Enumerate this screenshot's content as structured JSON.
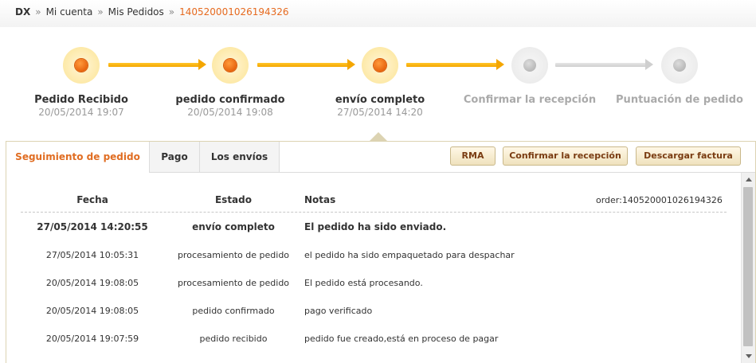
{
  "breadcrumb": {
    "home": "DX",
    "sep": "»",
    "items": [
      "Mi cuenta",
      "Mis Pedidos"
    ],
    "current": "140520001026194326"
  },
  "steps": [
    {
      "title": "Pedido Recibido",
      "time": "20/05/2014 19:07",
      "state": "done"
    },
    {
      "title": "pedido confirmado",
      "time": "20/05/2014 19:08",
      "state": "done"
    },
    {
      "title": "envío completo",
      "time": "27/05/2014 14:20",
      "state": "done"
    },
    {
      "title": "Confirmar la recepción",
      "time": "",
      "state": "todo"
    },
    {
      "title": "Puntuación de pedido",
      "time": "",
      "state": "todo"
    }
  ],
  "tabs": [
    {
      "label": "Seguimiento de pedido",
      "active": true
    },
    {
      "label": "Pago",
      "active": false
    },
    {
      "label": "Los envíos",
      "active": false
    }
  ],
  "actions": {
    "rma": "RMA",
    "confirm": "Confirmar la recepción",
    "invoice": "Descargar factura"
  },
  "table": {
    "headers": {
      "date": "Fecha",
      "status": "Estado",
      "notes": "Notas"
    },
    "order_ref": "order:140520001026194326",
    "rows": [
      {
        "date": "27/05/2014 14:20:55",
        "status": "envío completo",
        "notes": "El pedido ha sido enviado.",
        "highlight": true
      },
      {
        "date": "27/05/2014 10:05:31",
        "status": "procesamiento de pedido",
        "notes": "el pedido ha sido empaquetado para despachar",
        "highlight": false
      },
      {
        "date": "20/05/2014 19:08:05",
        "status": "procesamiento de pedido",
        "notes": "El pedido está procesando.",
        "highlight": false
      },
      {
        "date": "20/05/2014 19:08:05",
        "status": "pedido confirmado",
        "notes": "pago verificado",
        "highlight": false
      },
      {
        "date": "20/05/2014 19:07:59",
        "status": "pedido recibido",
        "notes": "pedido fue creado,está en proceso de pagar",
        "highlight": false
      }
    ]
  },
  "colors": {
    "accent": "#e06d22",
    "progress_done": "#f4a600",
    "progress_todo": "#cfcfcf"
  }
}
